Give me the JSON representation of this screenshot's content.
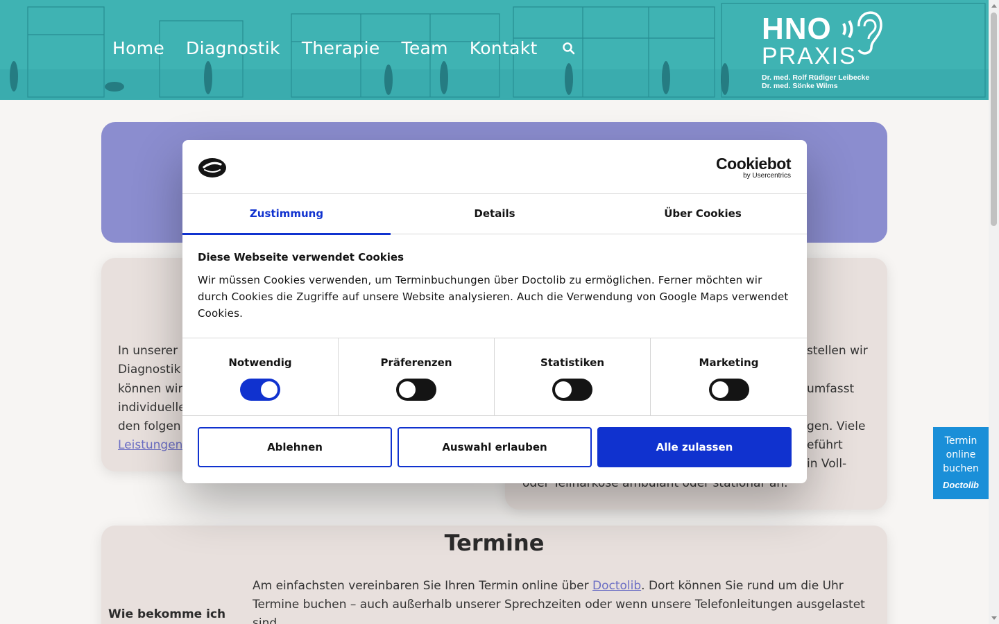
{
  "header": {
    "nav": [
      "Home",
      "Diagnostik",
      "Therapie",
      "Team",
      "Kontakt"
    ],
    "search_icon": "search-icon",
    "logo": {
      "line1": "HNO",
      "line2": "PRAXIS",
      "doctor1": "Dr. med. Rolf Rüdiger Leibecke",
      "doctor2": "Dr. med. Sönke Wilms"
    },
    "colors": {
      "background": "#3fb3b3",
      "text": "#ffffff"
    }
  },
  "content": {
    "left_card_lines": [
      "In unserer",
      "Diagnostik",
      "können wir",
      "individuelle",
      "den folgen"
    ],
    "left_card_link": "Leistungen",
    "right_card_lines": [
      "stellen wir",
      "",
      "umfasst",
      "",
      "gen. Viele",
      "eführt",
      "in Voll-"
    ],
    "right_card_last_line": "oder Teilnarkose ambulant oder stationär an.",
    "termine_title": "Termine",
    "termine_side": "Wie bekomme ich",
    "termine_text_1_pre": "Am einfachsten vereinbaren Sie Ihren Termin online über ",
    "termine_link": "Doctolib",
    "termine_text_1_post": ". Dort können Sie rund um die Uhr",
    "termine_text_2": "Termine buchen – auch außerhalb unserer Sprechzeiten oder wenn unsere Telefonleitungen ausgelastet",
    "termine_text_3": "sind."
  },
  "cookie_dialog": {
    "brand": "Cookiebot",
    "brand_sub": "by Usercentrics",
    "tabs": [
      "Zustimmung",
      "Details",
      "Über Cookies"
    ],
    "active_tab": "Zustimmung",
    "title": "Diese Webseite verwendet Cookies",
    "text": "Wir müssen Cookies verwenden, um Terminbuchungen über Doctolib zu ermöglichen. Ferner möchten wir durch Cookies die Zugriffe auf unsere Website analysieren. Auch die Verwendung von Google Maps verwendet Cookies.",
    "categories": [
      {
        "label": "Notwendig",
        "enabled": true
      },
      {
        "label": "Präferenzen",
        "enabled": false
      },
      {
        "label": "Statistiken",
        "enabled": false
      },
      {
        "label": "Marketing",
        "enabled": false
      }
    ],
    "buttons": {
      "decline": "Ablehnen",
      "allow_selection": "Auswahl erlauben",
      "allow_all": "Alle zulassen"
    },
    "colors": {
      "accent": "#1032cf",
      "toggle_off": "#141414"
    }
  },
  "doctolib_widget": {
    "text": "Termin online buchen",
    "brand": "Doctolib",
    "color": "#1a8fd8"
  }
}
